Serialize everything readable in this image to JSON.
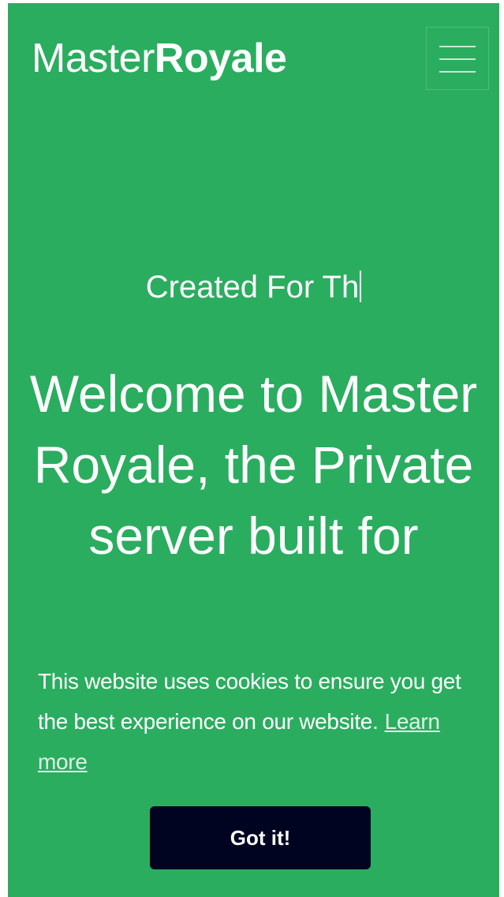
{
  "navbar": {
    "brand_regular": "Master",
    "brand_bold": "Royale",
    "menu_icon": "hamburger-menu-icon"
  },
  "hero": {
    "typed_text": "Created For Th",
    "headline": "Welcome to Master Royale, the Private server built for"
  },
  "cookie_banner": {
    "message": "This website uses cookies to ensure you get the best experience on our website.",
    "learn_more_label": "Learn more",
    "accept_label": "Got it!"
  },
  "colors": {
    "background": "#2aad5f",
    "text": "#ffffff",
    "button_bg": "#000420"
  }
}
